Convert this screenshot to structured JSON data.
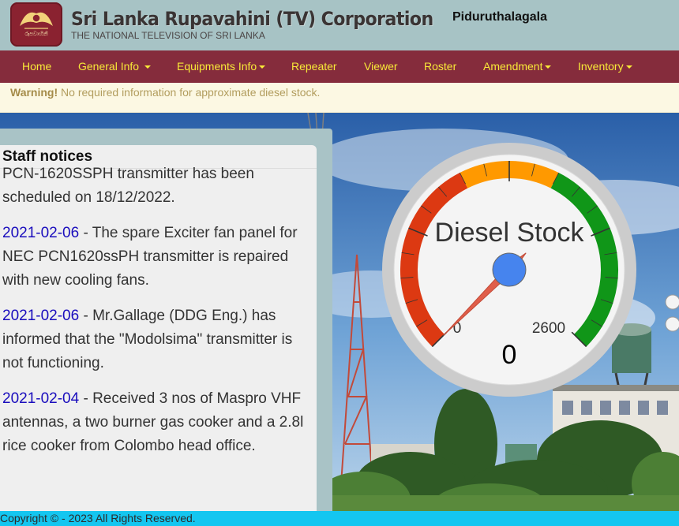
{
  "header": {
    "brand_title": "Sri Lanka Rupavahini (TV) Corporation",
    "brand_subtitle": "THE NATIONAL TELEVISION OF SRI LANKA",
    "logo_text": "රූපවාහිනී",
    "station": "Piduruthalagala"
  },
  "nav": {
    "items": [
      {
        "label": "Home",
        "dropdown": false
      },
      {
        "label": "General Info",
        "dropdown": true
      },
      {
        "label": "Equipments Info",
        "dropdown": true
      },
      {
        "label": "Repeater",
        "dropdown": false
      },
      {
        "label": "Viewer",
        "dropdown": false
      },
      {
        "label": "Roster",
        "dropdown": false
      },
      {
        "label": "Amendment",
        "dropdown": true
      },
      {
        "label": "Inventory",
        "dropdown": true
      }
    ]
  },
  "warning": {
    "strong": "Warning!",
    "message": "No required information for approximate diesel stock."
  },
  "notices": {
    "heading": "Staff notices",
    "partial": "PCN-1620SSPH transmitter has been scheduled on 18/12/2022.",
    "items": [
      {
        "date": "2021-02-06",
        "text": " - The spare Exciter fan panel for NEC PCN1620ssPH transmitter is repaired with new cooling fans."
      },
      {
        "date": "2021-02-06",
        "text": " - Mr.Gallage (DDG Eng.) has informed that the \"Modolsima\" transmitter is not functioning."
      },
      {
        "date": "2021-02-04",
        "text": " - Received 3 nos of Maspro VHF antennas, a two burner gas cooker and a 2.8l rice cooker from Colombo head office."
      }
    ]
  },
  "gauge": {
    "title": "Diesel Stock",
    "min_label": "0",
    "max_label": "2600",
    "value_label": "0",
    "min": 0,
    "max": 2600,
    "value": 0,
    "colors": {
      "red": "#dc3912",
      "orange": "#ff9900",
      "green": "#109618",
      "needle": "#e05e4a",
      "hub": "#4684ee"
    }
  },
  "footer": {
    "text": "Copyright © - 2023 All Rights Reserved."
  }
}
